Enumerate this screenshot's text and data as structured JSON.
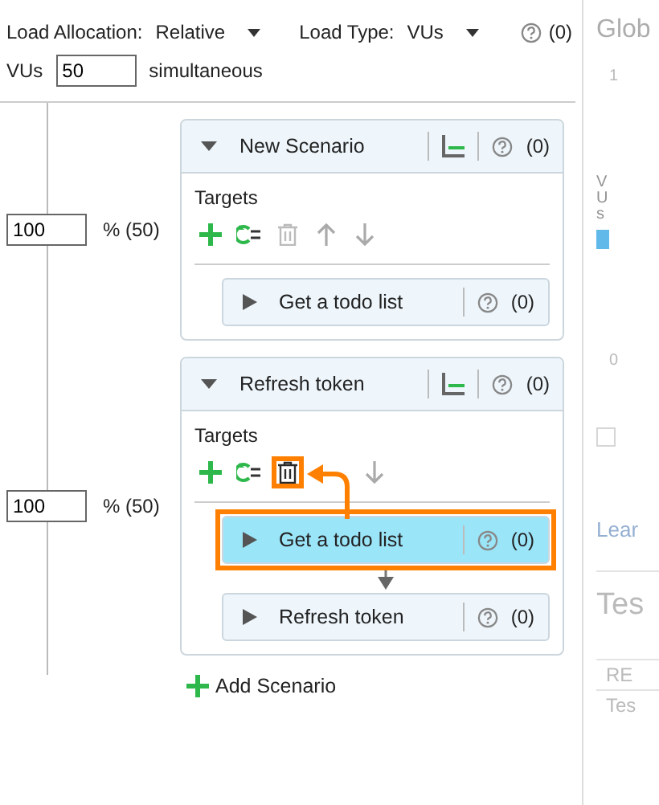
{
  "toolbar": {
    "allocation_label": "Load Allocation:",
    "allocation": "Relative",
    "type_label": "Load Type:",
    "type": "VUs",
    "issues": "(0)"
  },
  "vus": {
    "label": "VUs",
    "value": "50",
    "suffix": "simultaneous"
  },
  "scenarios": [
    {
      "name": "New Scenario",
      "expanded": true,
      "issues": "(0)",
      "share": "100",
      "share_label": "% (50)",
      "targets_label": "Targets",
      "tools": [
        {
          "kind": "add",
          "disabled": false,
          "highlighted": false
        },
        {
          "kind": "reload",
          "disabled": false,
          "highlighted": false
        },
        {
          "kind": "delete",
          "disabled": true,
          "highlighted": false
        },
        {
          "kind": "up",
          "disabled": true,
          "highlighted": false
        },
        {
          "kind": "down",
          "disabled": true,
          "highlighted": false
        }
      ],
      "targets": [
        {
          "name": "Get a todo list",
          "issues": "(0)",
          "selected": false,
          "highlighted": false
        }
      ]
    },
    {
      "name": "Refresh token",
      "expanded": true,
      "issues": "(0)",
      "share": "100",
      "share_label": "% (50)",
      "targets_label": "Targets",
      "tools": [
        {
          "kind": "add",
          "disabled": false,
          "highlighted": false
        },
        {
          "kind": "reload",
          "disabled": false,
          "highlighted": false
        },
        {
          "kind": "delete",
          "disabled": false,
          "highlighted": true
        },
        {
          "kind": "down",
          "disabled": true,
          "highlighted": false
        }
      ],
      "targets": [
        {
          "name": "Get a todo list",
          "issues": "(0)",
          "selected": true,
          "highlighted": true
        },
        {
          "name": "Refresh token",
          "issues": "(0)",
          "selected": false,
          "highlighted": false
        }
      ]
    }
  ],
  "add_scenario": "Add Scenario",
  "side_panel": {
    "title": "Glob",
    "y_max": "1",
    "y_label": "VUs",
    "y_min": "0",
    "link": "Lear",
    "heading": "Tes",
    "rows": [
      "RE",
      "Tes"
    ],
    "checked": false
  }
}
